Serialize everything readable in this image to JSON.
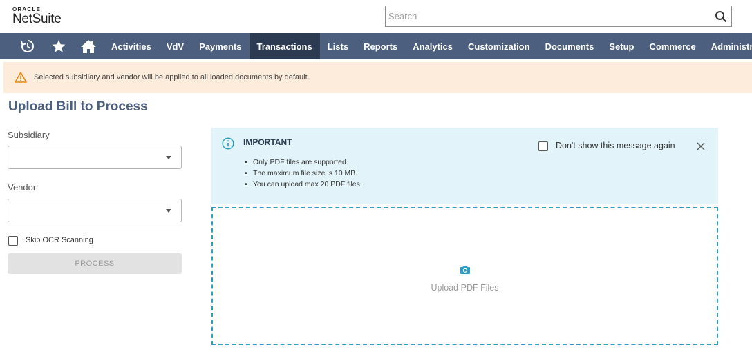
{
  "header": {
    "logo_top": "ORACLE",
    "logo_bottom": "NetSuite",
    "search_placeholder": "Search"
  },
  "nav": {
    "icons": [
      "recent-records-icon",
      "star-icon",
      "home-icon"
    ],
    "items": [
      {
        "label": "Activities"
      },
      {
        "label": "VdV"
      },
      {
        "label": "Payments"
      },
      {
        "label": "Transactions",
        "active": true
      },
      {
        "label": "Lists"
      },
      {
        "label": "Reports"
      },
      {
        "label": "Analytics"
      },
      {
        "label": "Customization"
      },
      {
        "label": "Documents"
      },
      {
        "label": "Setup"
      },
      {
        "label": "Commerce"
      },
      {
        "label": "Administrat"
      }
    ],
    "bg_color": "#4d5f7e",
    "active_color": "#2c3a52"
  },
  "alert": {
    "text": "Selected subsidiary and vendor will be applied to all loaded documents by default.",
    "icon": "warning-icon",
    "bg_color": "#fdecdc"
  },
  "page": {
    "title": "Upload Bill to Process"
  },
  "form": {
    "subsidiary_label": "Subsidiary",
    "subsidiary_value": "",
    "vendor_label": "Vendor",
    "vendor_value": "",
    "skip_ocr_label": "Skip OCR Scanning",
    "skip_ocr_checked": false,
    "process_button": "PROCESS"
  },
  "info": {
    "title": "IMPORTANT",
    "bullets": [
      "Only PDF files are supported.",
      "The maximum file size is 10 MB.",
      "You can upload max 20 PDF files."
    ],
    "dont_show_label": "Don't show this message again",
    "dont_show_checked": false,
    "bg_color": "#e2f3f9"
  },
  "dropzone": {
    "label": "Upload PDF Files",
    "icon": "camera-icon",
    "border_color": "#2b9fbf"
  }
}
